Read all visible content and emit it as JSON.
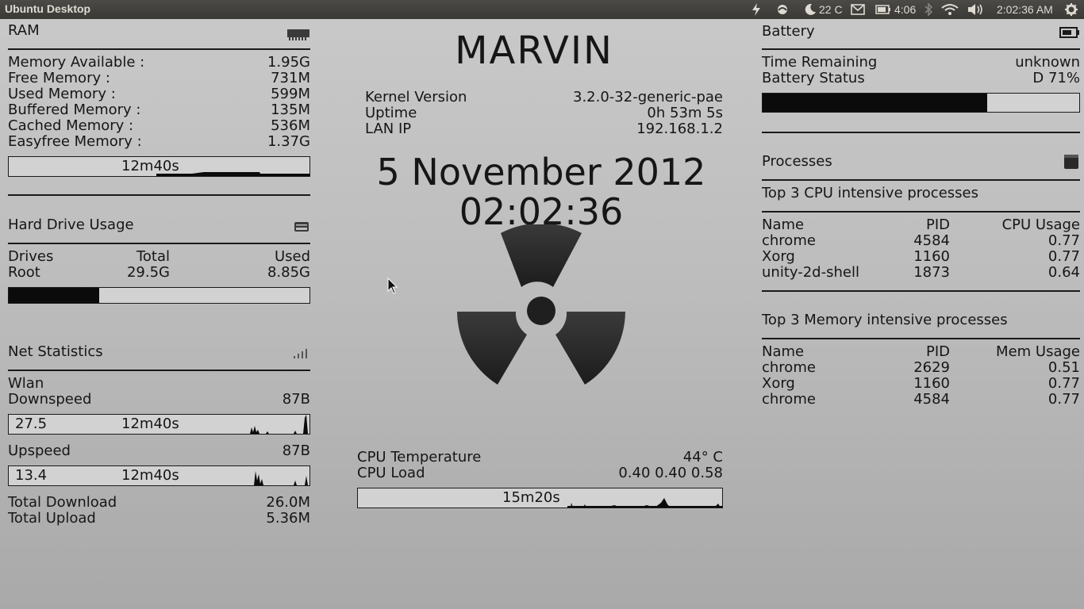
{
  "topbar": {
    "title": "Ubuntu Desktop",
    "weather": "22 C",
    "battery_time": "4:06",
    "clock": "2:02:36 AM",
    "icons": [
      "power-icon",
      "indicator-icon",
      "weather-icon",
      "mail-icon",
      "battery-icon",
      "bluetooth-icon",
      "wifi-icon",
      "volume-icon",
      "session-gear-icon"
    ]
  },
  "ram": {
    "title": "RAM",
    "icon": "memory-chip-icon",
    "rows": [
      {
        "label": "Memory Available :",
        "value": "1.95G"
      },
      {
        "label": "Free Memory :",
        "value": "731M"
      },
      {
        "label": "Used Memory :",
        "value": "599M"
      },
      {
        "label": "Buffered Memory :",
        "value": "135M"
      },
      {
        "label": "Cached Memory :",
        "value": "536M"
      },
      {
        "label": "Easyfree Memory :",
        "value": "1.37G"
      }
    ],
    "graph_label": "12m40s"
  },
  "hdd": {
    "title": "Hard Drive Usage",
    "icon": "hard-drive-icon",
    "col_drives": "Drives",
    "col_total": "Total",
    "col_used": "Used",
    "drive": "Root",
    "total": "29.5G",
    "used": "8.85G",
    "usage_fraction": 0.3
  },
  "net": {
    "title": "Net Statistics",
    "icon": "signal-bars-icon",
    "iface": "Wlan",
    "down_label": "Downspeed",
    "down_value": "87B",
    "down_graph_max": "27.5",
    "down_graph_span": "12m40s",
    "up_label": "Upspeed",
    "up_value": "87B",
    "up_graph_max": "13.4",
    "up_graph_span": "12m40s",
    "total_down_label": "Total Download",
    "total_down": "26.0M",
    "total_up_label": "Total Upload",
    "total_up": "5.36M"
  },
  "center": {
    "hostname": "MARVIN",
    "kernel_label": "Kernel Version",
    "kernel": "3.2.0-32-generic-pae",
    "uptime_label": "Uptime",
    "uptime": "0h 53m 5s",
    "lan_label": "LAN IP",
    "lan": "192.168.1.2",
    "date": "5 November 2012",
    "time": "02:02:36",
    "logo": "radiation-symbol-icon",
    "cpu_temp_label": "CPU Temperature",
    "cpu_temp": "44° C",
    "cpu_load_label": "CPU Load",
    "cpu_load": "0.40 0.40 0.58",
    "cpu_graph_label": "15m20s"
  },
  "battery": {
    "title": "Battery",
    "icon": "battery-outline-icon",
    "time_label": "Time Remaining",
    "time": "unknown",
    "status_label": "Battery Status",
    "status": "D 71%",
    "charge_fraction": 0.71
  },
  "processes": {
    "title": "Processes",
    "icon": "terminal-icon",
    "cpu_title": "Top 3 CPU intensive processes",
    "cpu_cols": [
      "Name",
      "PID",
      "CPU Usage"
    ],
    "cpu_rows": [
      {
        "name": "chrome",
        "pid": "4584",
        "usage": "0.77"
      },
      {
        "name": "Xorg",
        "pid": "1160",
        "usage": "0.77"
      },
      {
        "name": "unity-2d-shell",
        "pid": "1873",
        "usage": "0.64"
      }
    ],
    "mem_title": "Top 3 Memory intensive processes",
    "mem_cols": [
      "Name",
      "PID",
      "Mem Usage"
    ],
    "mem_rows": [
      {
        "name": "chrome",
        "pid": "2629",
        "usage": "0.51"
      },
      {
        "name": "Xorg",
        "pid": "1160",
        "usage": "0.77"
      },
      {
        "name": "chrome",
        "pid": "4584",
        "usage": "0.77"
      }
    ]
  },
  "colors": {
    "topbar": "#3c3b37",
    "text": "#161616",
    "bar_fill": "#0b0b0b",
    "background": "#bdbdbd"
  }
}
